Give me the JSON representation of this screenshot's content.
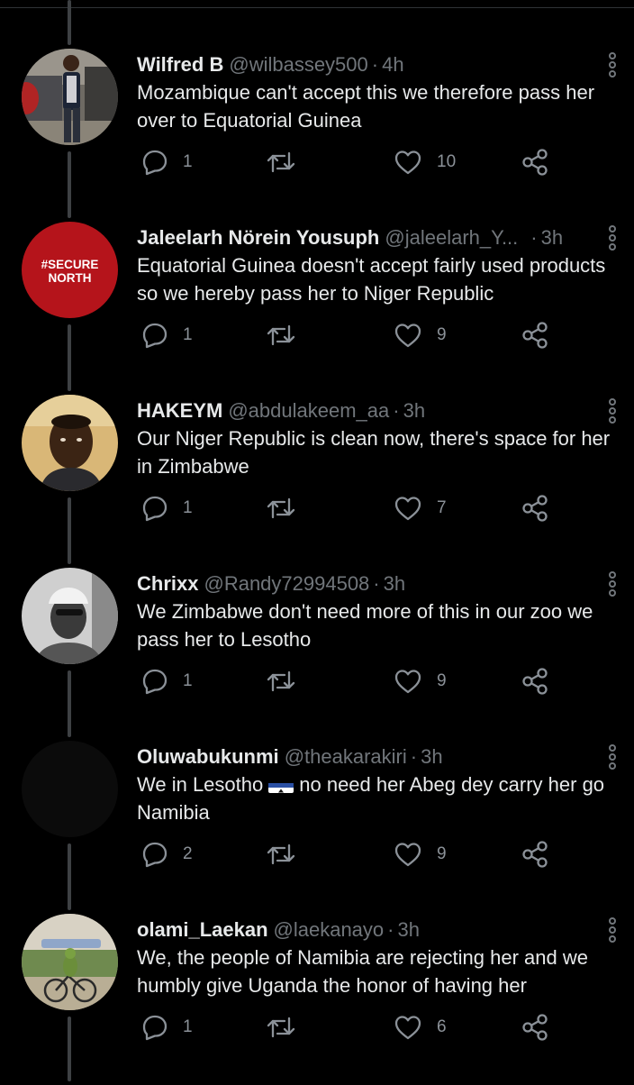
{
  "tweets": [
    {
      "name": "Wilfred B",
      "handle": "@wilbassey500",
      "time": "4h",
      "text_before": "Mozambique can't accept this we therefore pass her over to Equatorial Guinea",
      "text_after": "",
      "replies": "1",
      "likes": "10"
    },
    {
      "name": "Jaleelarh Nörein Yousuph",
      "handle": "@jaleelarh_Y...",
      "time": "3h",
      "text_before": "Equatorial Guinea doesn't accept fairly used products so we hereby pass her to Niger Republic",
      "text_after": "",
      "replies": "1",
      "likes": "9",
      "avatar_text_1": "#SECURE",
      "avatar_text_2": "NORTH"
    },
    {
      "name": "HAKEYM",
      "handle": "@abdulakeem_aa",
      "time": "3h",
      "text_before": "Our Niger Republic is clean now, there's space for her in Zimbabwe",
      "text_after": "",
      "replies": "1",
      "likes": "7"
    },
    {
      "name": "Chrixx",
      "handle": "@Randy72994508",
      "time": "3h",
      "text_before": "We Zimbabwe don't need more of this in our zoo we pass her to Lesotho",
      "text_after": "",
      "replies": "1",
      "likes": "9"
    },
    {
      "name": "Oluwabukunmi",
      "handle": "@theakarakiri",
      "time": "3h",
      "text_before": "We in Lesotho",
      "text_after": "no need her Abeg dey carry her go Namibia",
      "replies": "2",
      "likes": "9"
    },
    {
      "name": "olami_Laekan",
      "handle": "@laekanayo",
      "time": "3h",
      "text_before": "We, the people of Namibia are rejecting her and we humbly give Uganda the honor of having her",
      "text_after": "",
      "replies": "1",
      "likes": "6"
    }
  ],
  "colors": {
    "background": "#000000",
    "text": "#e7e9ea",
    "muted": "#71767b",
    "thread_line": "#3e4144",
    "secure_north_red": "#b5141b"
  },
  "icons": {
    "reply": "reply-icon",
    "retweet": "retweet-icon",
    "like": "heart-icon",
    "share": "share-icon",
    "more": "more-options-icon"
  }
}
